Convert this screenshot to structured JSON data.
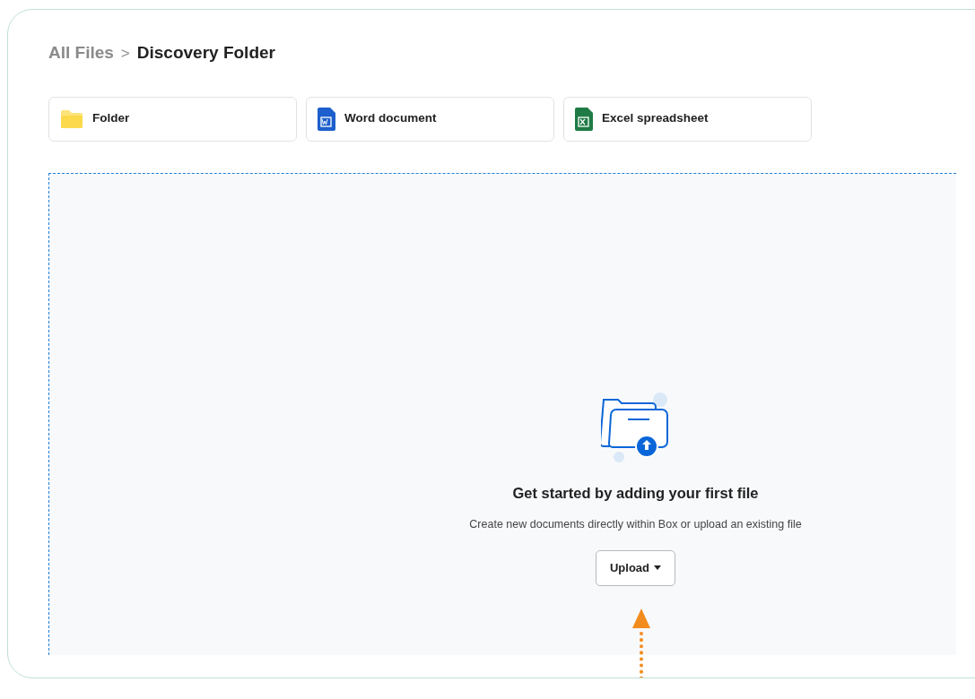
{
  "breadcrumb": {
    "parent": "All Files",
    "separator": ">",
    "current": "Discovery Folder"
  },
  "create_options": [
    {
      "kind": "folder",
      "label": "Folder"
    },
    {
      "kind": "word",
      "label": "Word document"
    },
    {
      "kind": "excel",
      "label": "Excel spreadsheet"
    }
  ],
  "empty_state": {
    "title": "Get started by adding your first file",
    "subtitle": "Create new documents directly within Box or upload an existing file",
    "button": "Upload"
  }
}
